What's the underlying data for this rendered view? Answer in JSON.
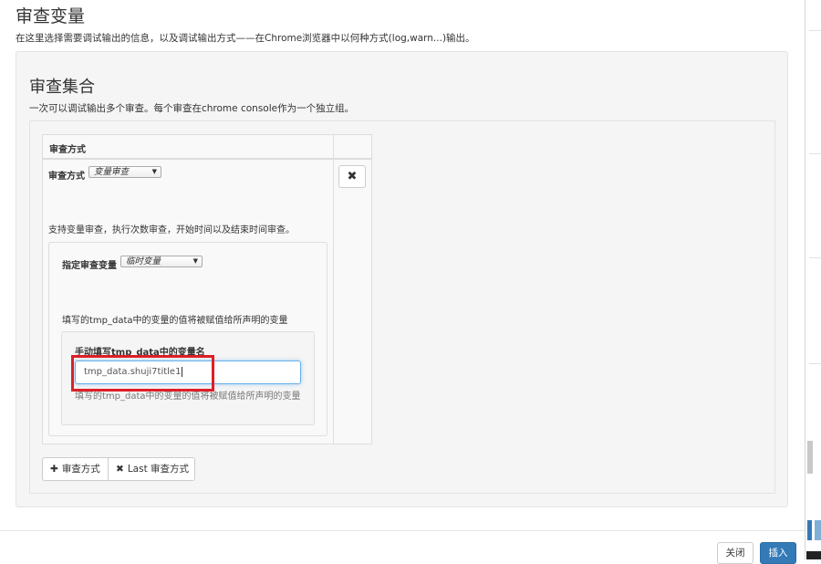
{
  "dialog": {
    "title": "审查变量",
    "description": "在这里选择需要调试输出的信息，以及调试输出方式——在Chrome浏览器中以何种方式(log,warn...)输出。"
  },
  "section": {
    "title": "审查集合",
    "description": "一次可以调试输出多个审查。每个审查在chrome console作为一个独立组。"
  },
  "table": {
    "header": "审查方式",
    "row": {
      "method_label": "审查方式",
      "method_value": "变量审查",
      "method_help": "支持变量审查，执行次数审查，开始时间以及结束时间审查。",
      "delete_icon": "close-icon"
    }
  },
  "variable": {
    "label": "指定审查变量",
    "value": "临时变量",
    "help": "填写的tmp_data中的变量的值将被赋值给所声明的变量"
  },
  "manual": {
    "label": "手动填写tmp_data中的变量名",
    "input_value": "tmp_data.shuji7title1",
    "help": "填写的tmp_data中的变量的值将被赋值给所声明的变量"
  },
  "actions": {
    "add_label": "审查方式",
    "add_icon": "plus-icon",
    "remove_last_label": "Last 审查方式",
    "remove_icon": "close-icon"
  },
  "footer": {
    "close_label": "关闭",
    "insert_label": "插入"
  },
  "colors": {
    "primary": "#337ab7",
    "highlight": "#dd1f26",
    "focus": "#66afe9"
  }
}
